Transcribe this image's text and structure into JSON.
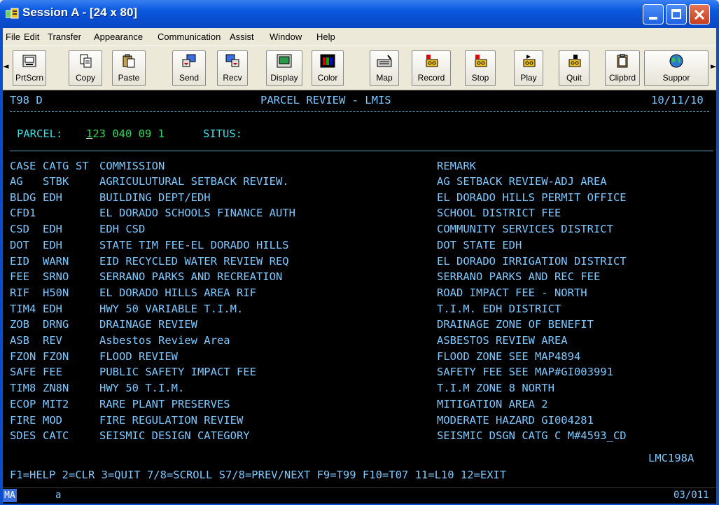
{
  "window": {
    "title": "Session A - [24 x 80]"
  },
  "menu": [
    "File",
    "Edit",
    "Transfer",
    "Appearance",
    "Communication",
    "Assist",
    "Window",
    "Help"
  ],
  "toolbar": {
    "scroll_left": "◄",
    "scroll_right": "►",
    "buttons": [
      {
        "label": "PrtScrn",
        "icon": "printer-icon"
      },
      {
        "label": "Copy",
        "icon": "copy-icon"
      },
      {
        "label": "Paste",
        "icon": "paste-icon"
      },
      {
        "label": "Send",
        "icon": "send-icon"
      },
      {
        "label": "Recv",
        "icon": "receive-icon"
      },
      {
        "label": "Display",
        "icon": "display-icon"
      },
      {
        "label": "Color",
        "icon": "color-icon"
      },
      {
        "label": "Map",
        "icon": "keyboard-map-icon"
      },
      {
        "label": "Record",
        "icon": "record-icon"
      },
      {
        "label": "Stop",
        "icon": "stop-icon"
      },
      {
        "label": "Play",
        "icon": "play-icon"
      },
      {
        "label": "Quit",
        "icon": "quit-icon"
      },
      {
        "label": "Clipbrd",
        "icon": "clipboard-icon"
      },
      {
        "label": "Suppor",
        "icon": "support-globe-icon"
      }
    ]
  },
  "terminal": {
    "header": {
      "left": "T98 D",
      "center": "PARCEL REVIEW - LMIS",
      "right": "10/11/10"
    },
    "parcel": {
      "label": "PARCEL:",
      "cursor_char": "1",
      "value": "23 040 09 1",
      "situs_label": "SITUS:"
    },
    "columns": {
      "case": "CASE",
      "catg": "CATG",
      "st": "ST",
      "commission": "COMMISSION",
      "remark": "REMARK"
    },
    "rows": [
      {
        "case": "AG",
        "catg": "STBK",
        "commission": "AGRICULUTURAL SETBACK REVIEW.",
        "remark": "AG SETBACK REVIEW-ADJ AREA"
      },
      {
        "case": "BLDG",
        "catg": "EDH",
        "commission": "BUILDING DEPT/EDH",
        "remark": "EL DORADO HILLS PERMIT OFFICE"
      },
      {
        "case": "CFD1",
        "catg": "",
        "commission": "EL DORADO SCHOOLS FINANCE AUTH",
        "remark": "SCHOOL DISTRICT FEE"
      },
      {
        "case": "CSD",
        "catg": "EDH",
        "commission": "EDH CSD",
        "remark": "COMMUNITY SERVICES DISTRICT"
      },
      {
        "case": "DOT",
        "catg": "EDH",
        "commission": "STATE TIM FEE-EL DORADO HILLS",
        "remark": "DOT STATE EDH"
      },
      {
        "case": "EID",
        "catg": "WARN",
        "commission": "EID RECYCLED WATER REVIEW REQ",
        "remark": "EL DORADO IRRIGATION DISTRICT"
      },
      {
        "case": "FEE",
        "catg": "SRNO",
        "commission": "SERRANO PARKS AND RECREATION",
        "remark": "SERRANO PARKS AND REC FEE"
      },
      {
        "case": "RIF",
        "catg": "H50N",
        "commission": "EL DORADO HILLS AREA RIF",
        "remark": "ROAD IMPACT FEE - NORTH"
      },
      {
        "case": "TIM4",
        "catg": "EDH",
        "commission": "HWY 50 VARIABLE T.I.M.",
        "remark": "T.I.M. EDH DISTRICT"
      },
      {
        "case": "ZOB",
        "catg": "DRNG",
        "commission": "DRAINAGE REVIEW",
        "remark": "DRAINAGE ZONE OF BENEFIT"
      },
      {
        "case": "ASB",
        "catg": "REV",
        "commission": "Asbestos Review Area",
        "remark": "ASBESTOS REVIEW AREA"
      },
      {
        "case": "FZON",
        "catg": "FZON",
        "commission": "FLOOD REVIEW",
        "remark": "FLOOD ZONE SEE MAP4894"
      },
      {
        "case": "SAFE",
        "catg": "FEE",
        "commission": "PUBLIC SAFETY IMPACT FEE",
        "remark": "SAFETY FEE SEE MAP#GI003991"
      },
      {
        "case": "TIM8",
        "catg": "ZN8N",
        "commission": "HWY 50 T.I.M.",
        "remark": "T.I.M ZONE 8 NORTH"
      },
      {
        "case": "ECOP",
        "catg": "MIT2",
        "commission": "RARE PLANT PRESERVES",
        "remark": "MITIGATION AREA 2"
      },
      {
        "case": "FIRE",
        "catg": "MOD",
        "commission": "FIRE REGULATION REVIEW",
        "remark": "MODERATE HAZARD GI004281"
      },
      {
        "case": "SDES",
        "catg": "CATC",
        "commission": "SEISMIC DESIGN CATEGORY",
        "remark": "SEISMIC DSGN CATG C M#4593_CD"
      }
    ],
    "program_id": "LMC198A",
    "function_keys": "F1=HELP 2=CLR 3=QUIT 7/8=SCROLL S7/8=PREV/NEXT F9=T99 F10=T07 11=L10 12=EXIT"
  },
  "status": {
    "mode": "MA",
    "session": "a",
    "cursor_pos": "03/011"
  },
  "colors": {
    "title_blue": "#0a4ed0",
    "terminal_text": "#7ec8ff",
    "terminal_input": "#30d75a",
    "terminal_bg": "#000000"
  }
}
